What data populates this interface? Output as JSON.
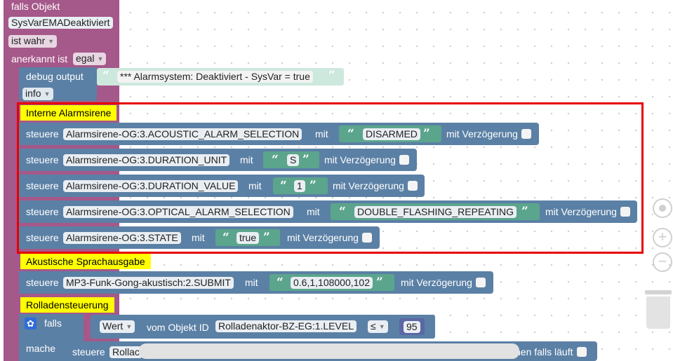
{
  "if_block": {
    "label_if": "falls Objekt",
    "object": "SysVarEMADeaktiviert",
    "condition": "ist wahr",
    "ack_label": "anerkannt ist",
    "ack_value": "egal"
  },
  "debug": {
    "label": "debug output",
    "message": "*** Alarmsystem: Deaktiviert - SysVar = true",
    "level": "info"
  },
  "comments": {
    "siren": "Interne Alarmsirene",
    "speech": "Akustische Sprachausgabe",
    "blinds": "Rolladensteuerung"
  },
  "control_rows": [
    {
      "verb": "steuere",
      "object": "Alarmsirene-OG:3.ACOUSTIC_ALARM_SELECTION",
      "with": "mit",
      "value": "DISARMED",
      "delay": "mit Verzögerung"
    },
    {
      "verb": "steuere",
      "object": "Alarmsirene-OG:3.DURATION_UNIT",
      "with": "mit",
      "value": "S",
      "delay": "mit Verzögerung"
    },
    {
      "verb": "steuere",
      "object": "Alarmsirene-OG:3.DURATION_VALUE",
      "with": "mit",
      "value": "1",
      "delay": "mit Verzögerung"
    },
    {
      "verb": "steuere",
      "object": "Alarmsirene-OG:3.OPTICAL_ALARM_SELECTION",
      "with": "mit",
      "value": "DOUBLE_FLASHING_REPEATING",
      "delay": "mit Verzögerung"
    },
    {
      "verb": "steuere",
      "object": "Alarmsirene-OG:3.STATE",
      "with": "mit",
      "value": "true",
      "delay": "mit Verzögerung"
    }
  ],
  "speech_row": {
    "verb": "steuere",
    "object": "MP3-Funk-Gong-akustisch:2.SUBMIT",
    "with": "mit",
    "value": "0.6,1,108000,102",
    "delay": "mit Verzögerung"
  },
  "blinds_if": {
    "label_if": "falls",
    "value_type": "Wert",
    "from_label": "vom Objekt ID",
    "object": "Rolladenaktor-BZ-EG:1.LEVEL",
    "operator": "≤",
    "number": "95",
    "do_label": "mache"
  },
  "blinds_row": {
    "verb": "steuere",
    "object_partial": "Rollac",
    "tail": "hen falls läuft"
  },
  "colors": {
    "event_block": "#a5588a",
    "action_block": "#5b80a5",
    "text_block": "#5ba58c",
    "comment": "#ffff00",
    "highlight": "#e60000"
  },
  "icons": [
    "gear-icon",
    "target-icon",
    "zoom-in-icon",
    "zoom-out-icon",
    "trash-icon"
  ]
}
